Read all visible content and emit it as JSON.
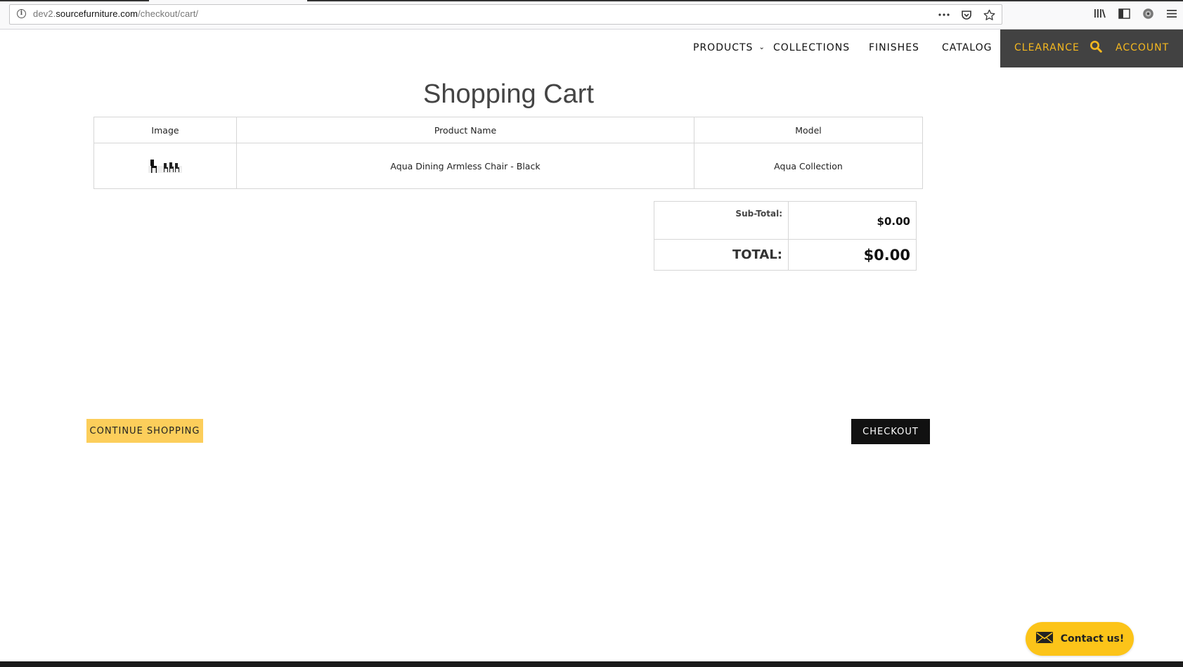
{
  "browser": {
    "url_prefix": "dev2.",
    "url_domain": "sourcefurniture.com",
    "url_path": "/checkout/cart/",
    "icons": [
      "info-icon",
      "more-icon",
      "pocket-icon",
      "bookmark-star-icon",
      "library-icon",
      "sidebar-icon",
      "extension-icon",
      "menu-icon"
    ]
  },
  "nav": {
    "products": "PRODUCTS",
    "collections": "COLLECTIONS",
    "finishes": "FINISHES",
    "catalog": "CATALOG",
    "clearance": "CLEARANCE",
    "account": "ACCOUNT",
    "accent_color": "#f5b81f"
  },
  "cart": {
    "title": "Shopping Cart",
    "headers": {
      "image": "Image",
      "product_name": "Product Name",
      "model": "Model"
    },
    "items": [
      {
        "image_icon": "chair-set-thumbnail",
        "product_name": "Aqua Dining Armless Chair - Black",
        "model": "Aqua Collection"
      }
    ]
  },
  "totals": {
    "subtotal_label": "Sub-Total:",
    "subtotal_value": "$0.00",
    "total_label": "TOTAL:",
    "total_value": "$0.00"
  },
  "actions": {
    "continue_shopping": "CONTINUE SHOPPING",
    "checkout": "CHECKOUT",
    "continue_color": "#fcce5b",
    "checkout_color": "#111111"
  },
  "contact": {
    "label": "Contact us!",
    "icon": "envelope-icon",
    "color": "#fcc419"
  }
}
